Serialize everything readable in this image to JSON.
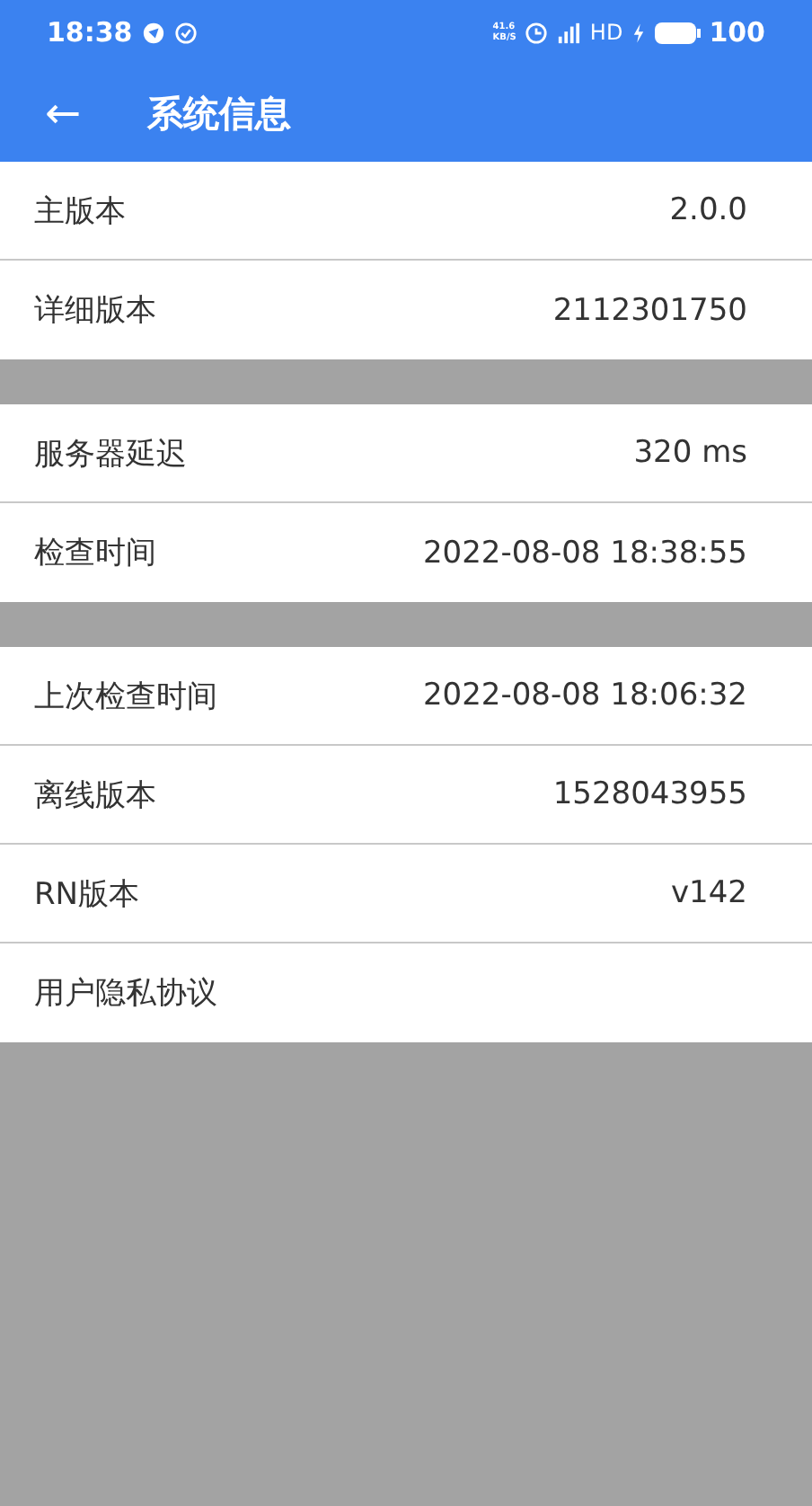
{
  "status_bar": {
    "time": "18:38",
    "net_speed": "41.6",
    "net_unit": "KB/S",
    "network": "HD",
    "battery": "100"
  },
  "app_bar": {
    "back": "←",
    "title": "系统信息"
  },
  "groups": [
    {
      "rows": [
        {
          "label": "主版本",
          "value": "2.0.0"
        },
        {
          "label": "详细版本",
          "value": "2112301750"
        }
      ]
    },
    {
      "rows": [
        {
          "label": "服务器延迟",
          "value": "320 ms"
        },
        {
          "label": "检查时间",
          "value": "2022-08-08 18:38:55"
        }
      ]
    },
    {
      "rows": [
        {
          "label": "上次检查时间",
          "value": "2022-08-08 18:06:32"
        },
        {
          "label": "离线版本",
          "value": "1528043955"
        },
        {
          "label": "RN版本",
          "value": "v142"
        },
        {
          "label": "用户隐私协议"
        }
      ]
    }
  ]
}
